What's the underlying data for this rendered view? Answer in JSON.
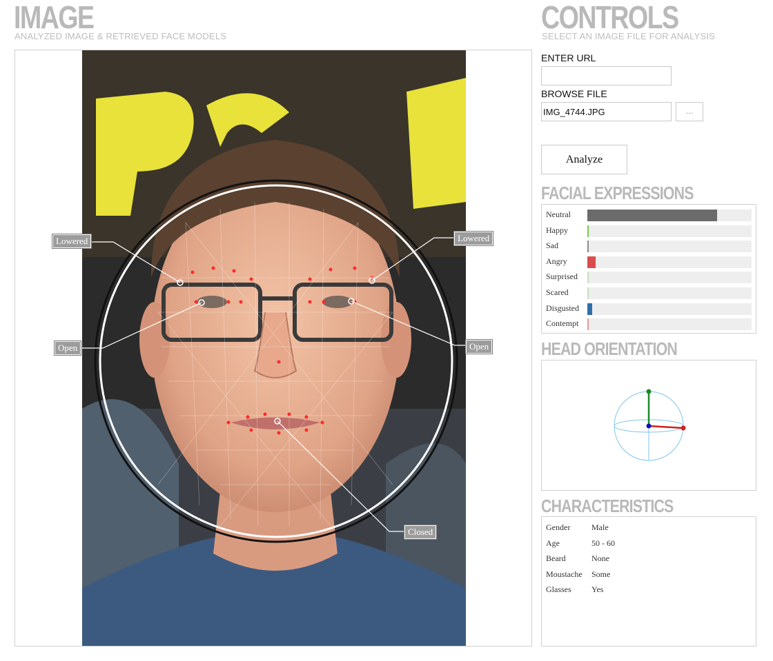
{
  "image_section": {
    "title": "IMAGE",
    "subtitle": "ANALYZED IMAGE & RETRIEVED FACE MODELS",
    "annotations": {
      "left_brow": "Lowered",
      "right_brow": "Lowered",
      "left_eye": "Open",
      "right_eye": "Open",
      "mouth": "Closed"
    }
  },
  "controls": {
    "title": "CONTROLS",
    "subtitle": "SELECT AN IMAGE FILE FOR ANALYSIS",
    "url_label": "ENTER URL",
    "url_value": "",
    "browse_label": "BROWSE FILE",
    "file_value": "IMG_4744.JPG",
    "browse_button": "...",
    "analyze_button": "Analyze"
  },
  "facial_expressions": {
    "title": "FACIAL EXPRESSIONS",
    "items": [
      {
        "name": "Neutral",
        "value": 0.79,
        "color": "#6b6b6b"
      },
      {
        "name": "Happy",
        "value": 0.01,
        "color": "#7ec850"
      },
      {
        "name": "Sad",
        "value": 0.01,
        "color": "#8a8a8a"
      },
      {
        "name": "Angry",
        "value": 0.05,
        "color": "#d94d4d"
      },
      {
        "name": "Surprised",
        "value": 0.004,
        "color": "#c7e0c0"
      },
      {
        "name": "Scared",
        "value": 0.004,
        "color": "#c7e0c0"
      },
      {
        "name": "Disgusted",
        "value": 0.03,
        "color": "#2f6fa8"
      },
      {
        "name": "Contempt",
        "value": 0.008,
        "color": "#e59a9a"
      }
    ]
  },
  "head_orientation": {
    "title": "HEAD ORIENTATION",
    "colors": {
      "sphere": "#7fc6ec",
      "y_axis": "#1a8a2a",
      "x_axis": "#d02020",
      "z_axis": "#1010c0"
    }
  },
  "characteristics": {
    "title": "CHARACTERISTICS",
    "rows": [
      {
        "key": "Gender",
        "value": "Male"
      },
      {
        "key": "Age",
        "value": "50 - 60"
      },
      {
        "key": "Beard",
        "value": "None"
      },
      {
        "key": "Moustache",
        "value": "Some"
      },
      {
        "key": "Glasses",
        "value": "Yes"
      }
    ]
  }
}
